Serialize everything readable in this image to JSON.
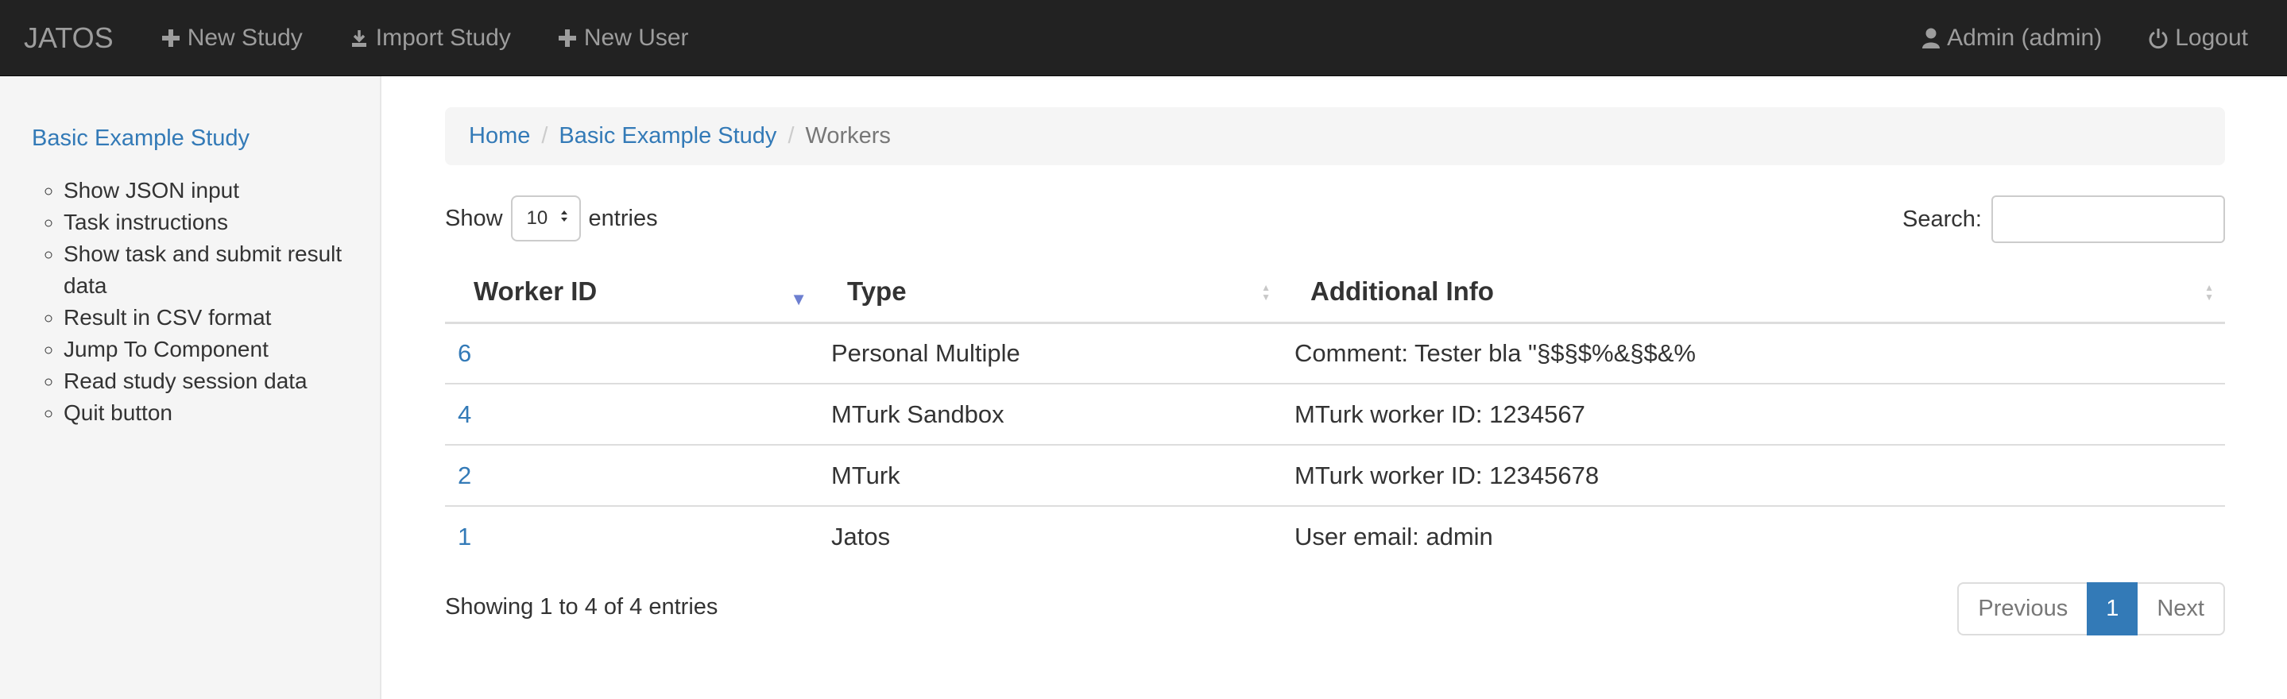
{
  "navbar": {
    "brand": "JATOS",
    "new_study": "New Study",
    "import_study": "Import Study",
    "new_user": "New User",
    "user": "Admin (admin)",
    "logout": "Logout"
  },
  "sidebar": {
    "title": "Basic Example Study",
    "items": [
      {
        "label": "Show JSON input"
      },
      {
        "label": "Task instructions"
      },
      {
        "label": "Show task and submit result data"
      },
      {
        "label": "Result in CSV format"
      },
      {
        "label": "Jump To Component"
      },
      {
        "label": "Read study session data"
      },
      {
        "label": "Quit button"
      }
    ]
  },
  "breadcrumb": {
    "home": "Home",
    "study": "Basic Example Study",
    "current": "Workers"
  },
  "controls": {
    "show_label": "Show",
    "entries_value": "10",
    "entries_label": "entries",
    "search_label": "Search:",
    "search_value": ""
  },
  "table": {
    "headers": {
      "worker_id": "Worker ID",
      "type": "Type",
      "info": "Additional Info"
    },
    "rows": [
      {
        "id": "6",
        "type": "Personal Multiple",
        "info": "Comment: Tester bla \"§$§$%&§$&%"
      },
      {
        "id": "4",
        "type": "MTurk Sandbox",
        "info": "MTurk worker ID: 1234567"
      },
      {
        "id": "2",
        "type": "MTurk",
        "info": "MTurk worker ID: 12345678"
      },
      {
        "id": "1",
        "type": "Jatos",
        "info": "User email: admin"
      }
    ]
  },
  "footer": {
    "info": "Showing 1 to 4 of 4 entries",
    "previous": "Previous",
    "page": "1",
    "next": "Next"
  },
  "colors": {
    "link": "#337ab7",
    "navbar": "#222222",
    "sort_active": "#6d7fd0"
  }
}
